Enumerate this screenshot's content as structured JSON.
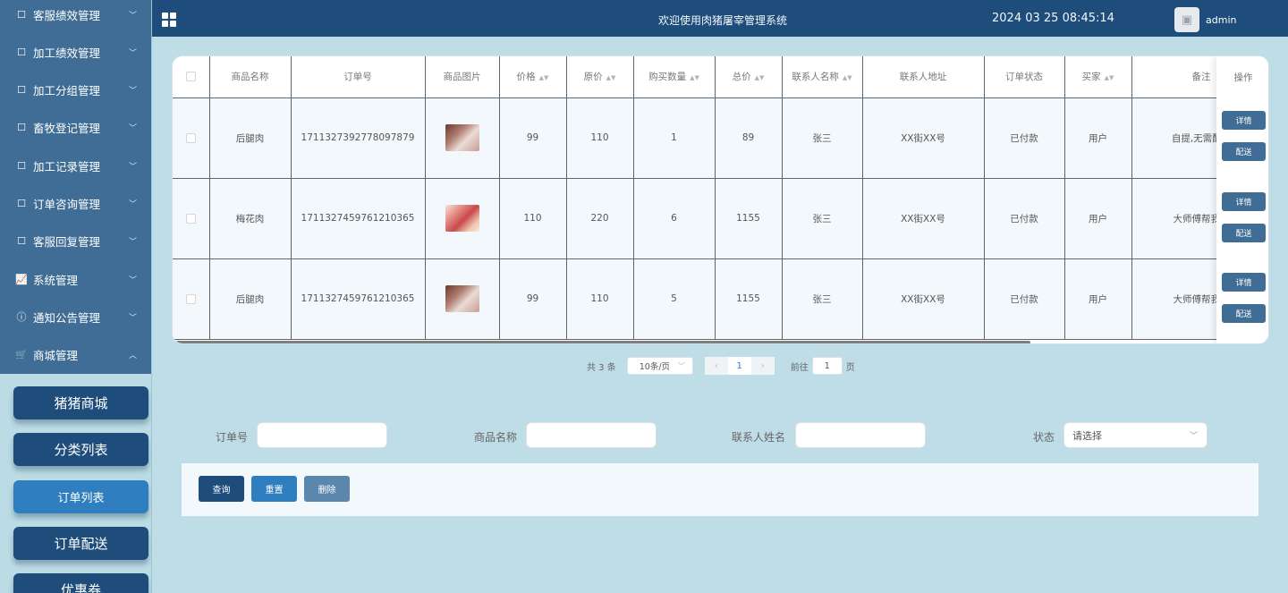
{
  "header": {
    "title": "欢迎使用肉猪屠宰管理系统",
    "datetime": "2024 03 25 08:45:14",
    "user": "admin"
  },
  "sidebar": {
    "menu": [
      {
        "label": "客服绩效管理",
        "icon": "doc-icon",
        "glyph": "☐",
        "arrow": "﹀"
      },
      {
        "label": "加工绩效管理",
        "icon": "doc-icon",
        "glyph": "☐",
        "arrow": "﹀"
      },
      {
        "label": "加工分组管理",
        "icon": "doc-icon",
        "glyph": "☐",
        "arrow": "﹀"
      },
      {
        "label": "畜牧登记管理",
        "icon": "doc-icon",
        "glyph": "☐",
        "arrow": "﹀"
      },
      {
        "label": "加工记录管理",
        "icon": "doc-icon",
        "glyph": "☐",
        "arrow": "﹀"
      },
      {
        "label": "订单咨询管理",
        "icon": "doc-icon",
        "glyph": "☐",
        "arrow": "﹀"
      },
      {
        "label": "客服回复管理",
        "icon": "doc-icon",
        "glyph": "☐",
        "arrow": "﹀"
      },
      {
        "label": "系统管理",
        "icon": "chart-icon",
        "glyph": "📈",
        "arrow": "﹀"
      },
      {
        "label": "通知公告管理",
        "icon": "info-icon",
        "glyph": "ⓘ",
        "arrow": "﹀"
      },
      {
        "label": "商城管理",
        "icon": "cart-icon",
        "glyph": "🛒",
        "arrow": "︿"
      }
    ],
    "submenu": [
      {
        "label": "猪猪商城",
        "active": false
      },
      {
        "label": "分类列表",
        "active": false
      },
      {
        "label": "订单列表",
        "active": true
      },
      {
        "label": "订单配送",
        "active": false
      },
      {
        "label": "优惠券",
        "active": false
      }
    ]
  },
  "table": {
    "columns": [
      {
        "label": "",
        "sortable": false
      },
      {
        "label": "商品名称",
        "sortable": false
      },
      {
        "label": "订单号",
        "sortable": false
      },
      {
        "label": "商品图片",
        "sortable": false
      },
      {
        "label": "价格",
        "sortable": true
      },
      {
        "label": "原价",
        "sortable": true
      },
      {
        "label": "购买数量",
        "sortable": true
      },
      {
        "label": "总价",
        "sortable": true
      },
      {
        "label": "联系人名称",
        "sortable": true
      },
      {
        "label": "联系人地址",
        "sortable": false
      },
      {
        "label": "订单状态",
        "sortable": false
      },
      {
        "label": "买家",
        "sortable": true
      },
      {
        "label": "备注",
        "sortable": false
      }
    ],
    "op_header": "操作",
    "rows": [
      {
        "name": "后腿肉",
        "order_no": "1711327392778097879",
        "image": "pork-leg",
        "price": "99",
        "original": "110",
        "qty": "1",
        "total": "89",
        "contact": "张三",
        "address": "XX街XX号",
        "status": "已付款",
        "buyer": "用户",
        "remark": "自提,无需配送"
      },
      {
        "name": "梅花肉",
        "order_no": "1711327459761210365",
        "image": "pork-shoulder",
        "price": "110",
        "original": "220",
        "qty": "6",
        "total": "1155",
        "contact": "张三",
        "address": "XX街XX号",
        "status": "已付款",
        "buyer": "用户",
        "remark": "大师傅帮我切"
      },
      {
        "name": "后腿肉",
        "order_no": "1711327459761210365",
        "image": "pork-leg",
        "price": "99",
        "original": "110",
        "qty": "5",
        "total": "1155",
        "contact": "张三",
        "address": "XX街XX号",
        "status": "已付款",
        "buyer": "用户",
        "remark": "大师傅帮我切"
      }
    ],
    "row_actions": {
      "detail": "详情",
      "deliver": "配送"
    }
  },
  "pagination": {
    "total_text": "共 3 条",
    "page_size": "10条/页",
    "current_page": "1",
    "goto_prefix": "前往",
    "goto_value": "1",
    "goto_suffix": "页"
  },
  "search": {
    "order_no_label": "订单号",
    "product_label": "商品名称",
    "contact_label": "联系人姓名",
    "status_label": "状态",
    "status_placeholder": "请选择"
  },
  "actions": {
    "query": "查询",
    "reset": "重置",
    "delete": "删除"
  },
  "colors": {
    "header_bg": "#1e4d7b",
    "menu_bg": "#3f6d95",
    "page_bg": "#bfdde6",
    "active_sub": "#2f7fc0",
    "reset_btn": "#2f7fc0",
    "delete_btn": "#5c87ad"
  }
}
